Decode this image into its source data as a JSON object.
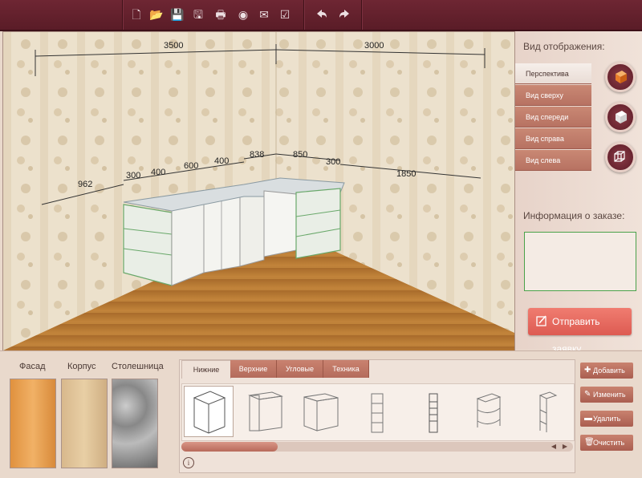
{
  "toolbar": {
    "buttons": [
      {
        "icon": "new-file-icon",
        "glyph": "🗋"
      },
      {
        "icon": "open-folder-icon",
        "glyph": "📂"
      },
      {
        "icon": "save-icon",
        "glyph": "💾"
      },
      {
        "icon": "save-as-icon",
        "glyph": "🖫"
      },
      {
        "icon": "print-icon",
        "glyph": "🖶"
      },
      {
        "icon": "camera-icon",
        "glyph": "◉"
      },
      {
        "icon": "mail-icon",
        "glyph": "✉"
      },
      {
        "icon": "checkbox-icon",
        "glyph": "☑"
      },
      {
        "icon": "undo-icon",
        "glyph": "◀"
      },
      {
        "icon": "redo-icon",
        "glyph": "▶"
      }
    ]
  },
  "viewport": {
    "dimensions": {
      "left_wall_total": "3500",
      "right_wall_total": "3000",
      "d_962": "962",
      "d_300a": "300",
      "d_400a": "400",
      "d_600": "600",
      "d_400b": "400",
      "d_838": "838",
      "d_850": "850",
      "d_300b": "300",
      "d_1850": "1850"
    }
  },
  "right_panel": {
    "view_heading": "Вид отображения:",
    "views": [
      "Перспектива",
      "Вид сверху",
      "Вид спереди",
      "Вид справа",
      "Вид слева"
    ],
    "active_view": "Перспектива",
    "info_heading": "Информация о заказе:",
    "submit_label": "Отправить заявку"
  },
  "materials": {
    "facade_label": "Фасад",
    "body_label": "Корпус",
    "countertop_label": "Столешница"
  },
  "catalog": {
    "tabs": [
      "Нижние",
      "Верхние",
      "Угловые",
      "Техника"
    ],
    "active_tab": "Нижние"
  },
  "actions": {
    "add": "Добавить",
    "edit": "Изменить",
    "delete": "Удалить",
    "clear": "Очистить"
  },
  "colors": {
    "toolbar": "#5f1e2a",
    "accent": "#b86f5f",
    "submit": "#e4665c",
    "order_border": "#4aa24a"
  }
}
